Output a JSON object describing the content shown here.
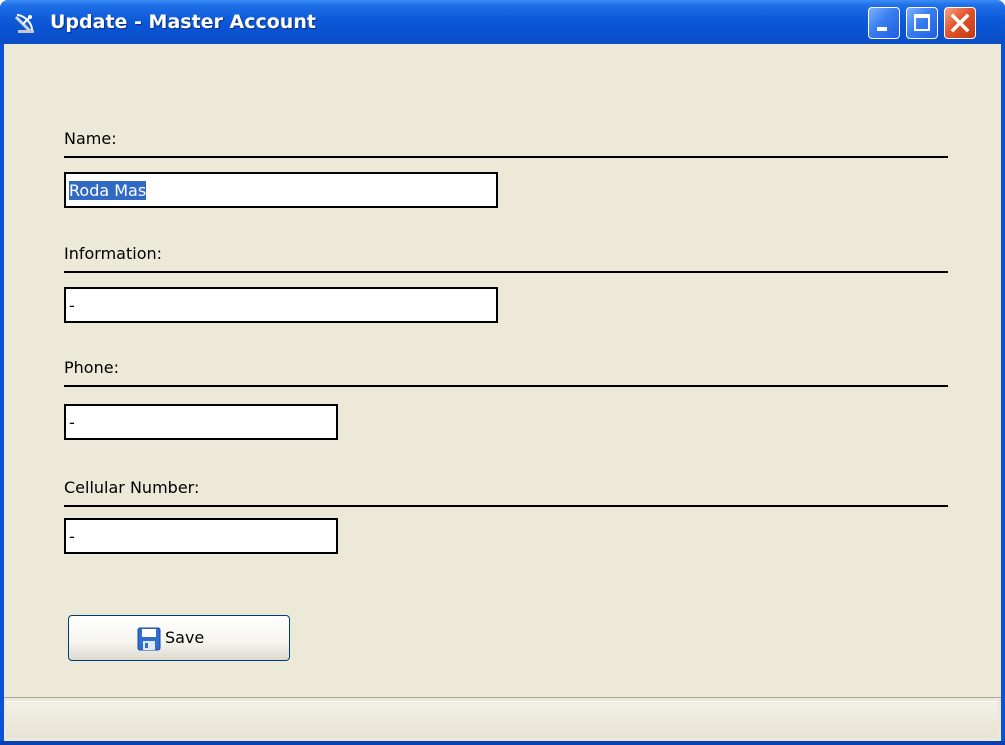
{
  "window": {
    "title": "Update - Master Account"
  },
  "form": {
    "name_label": "Name:",
    "name_value": "Roda Mas",
    "information_label": "Information:",
    "information_value": "-",
    "phone_label": "Phone:",
    "phone_value": "-",
    "cellular_label": "Cellular Number:",
    "cellular_value": "-"
  },
  "actions": {
    "save_label": "Save"
  },
  "icons": {
    "app": "satellite-dish-icon",
    "save": "floppy-disk-icon",
    "minimize": "minimize-icon",
    "maximize": "maximize-icon",
    "close": "close-icon"
  },
  "colors": {
    "titlebar": "#0a52d2",
    "client_background": "#ece9d8",
    "selection": "#316ac5",
    "close_button": "#e2542c"
  }
}
